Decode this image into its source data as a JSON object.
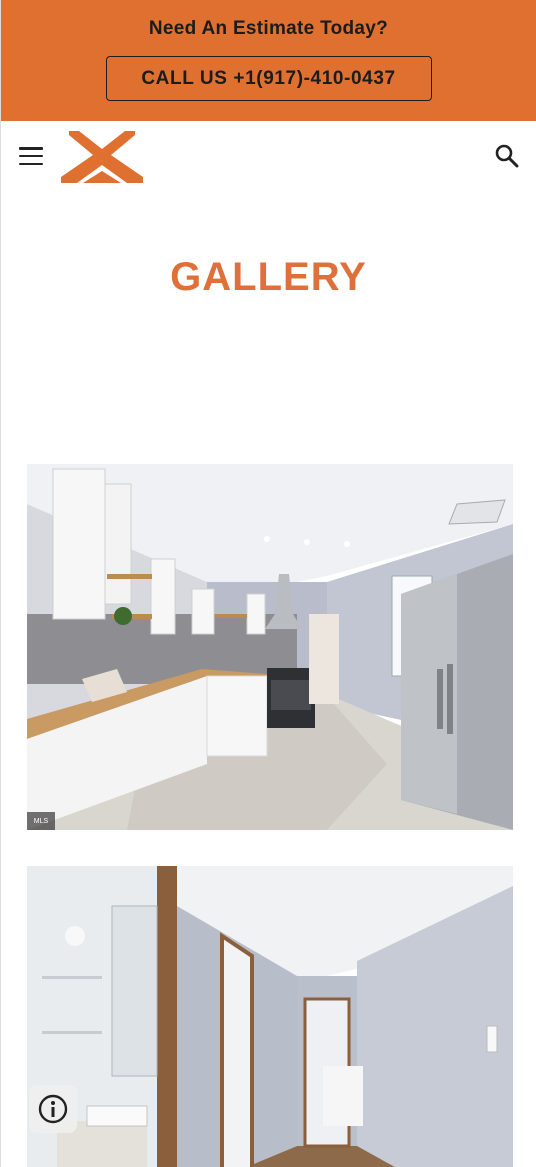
{
  "promo": {
    "title": "Need An Estimate Today?",
    "call_button": "CALL US +1(917)-410-0437"
  },
  "header": {
    "menu_icon": "hamburger-menu-icon",
    "logo_icon": "house-roof-logo",
    "search_icon": "search-icon"
  },
  "page": {
    "title": "GALLERY"
  },
  "gallery": {
    "photos": [
      {
        "subject": "kitchen",
        "badge": "MLS"
      },
      {
        "subject": "hallway"
      }
    ]
  },
  "colors": {
    "accent": "#e07030",
    "title": "#e0703a",
    "text_dark": "#1c1c1c"
  },
  "floating": {
    "info_icon": "info-icon"
  }
}
